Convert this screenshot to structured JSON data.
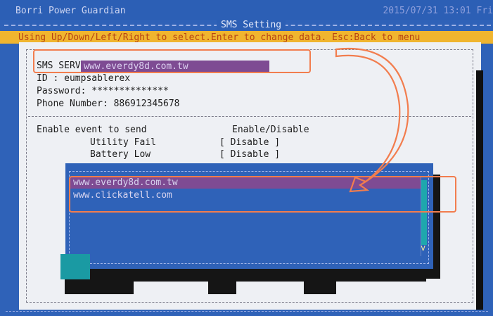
{
  "app": {
    "title": "Borri Power Guardian",
    "datetime": "2015/07/31 13:01 Fri",
    "screen_title": "SMS Setting",
    "hint": "Using Up/Down/Left/Right to select.Enter to change data. Esc:Back to menu"
  },
  "form": {
    "sms_server_label": "SMS SERVER:",
    "sms_server_value": "www.everdy8d.com.tw",
    "id_line": "ID : eumpsablerex",
    "password_line": "Password: **************",
    "phone_line": "Phone Number: 886912345678"
  },
  "events": {
    "heading": "Enable event to send",
    "column_heading": "Enable/Disable",
    "utility_fail_label": "Utility Fail",
    "utility_fail_value": "[ Disable ]",
    "battery_low_label": "Battery Low",
    "battery_low_value": "[ Disable ]"
  },
  "dropdown": {
    "options": [
      "www.everdy8d.com.tw",
      "www.clickatell.com"
    ],
    "selected_index": 0,
    "scroll_arrow": "v"
  },
  "colors": {
    "screen_blue": "#2f62b8",
    "hint_yellow": "#f0b52f",
    "selection_purple": "#7e4b93",
    "callout_orange": "#f27d4e"
  }
}
